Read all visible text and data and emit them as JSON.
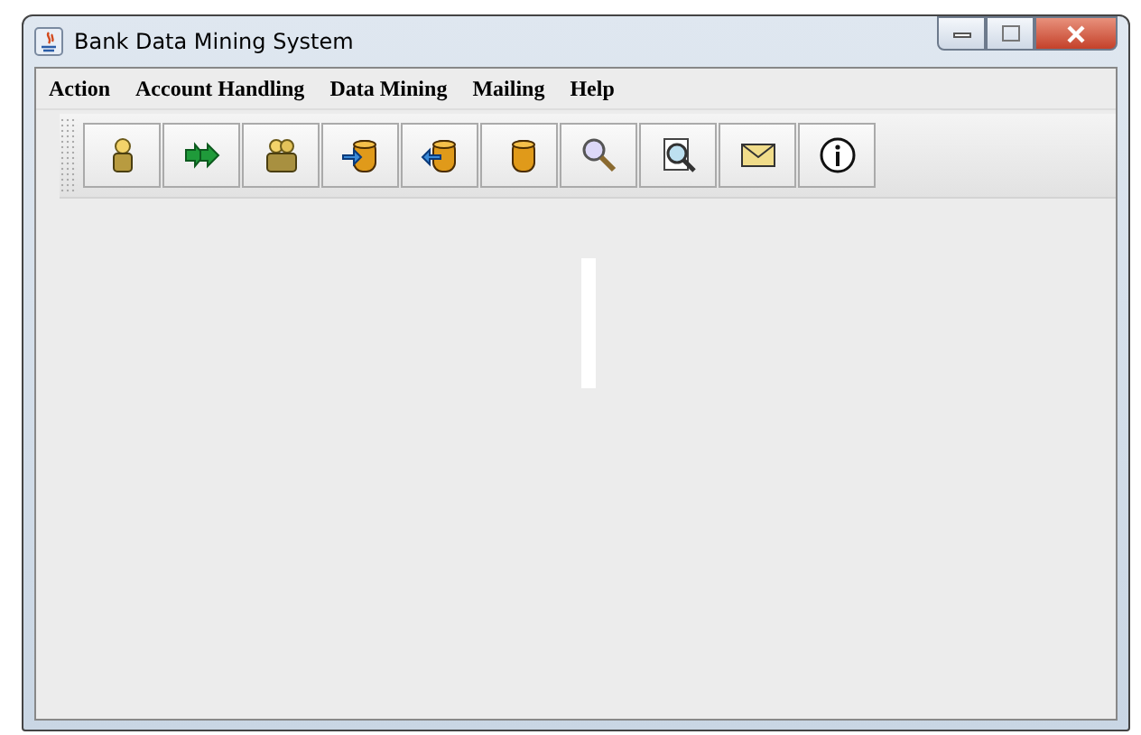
{
  "window": {
    "title": "Bank Data Mining System"
  },
  "menu": [
    "Action",
    "Account Handling",
    "Data Mining",
    "Mailing",
    "Help"
  ]
}
